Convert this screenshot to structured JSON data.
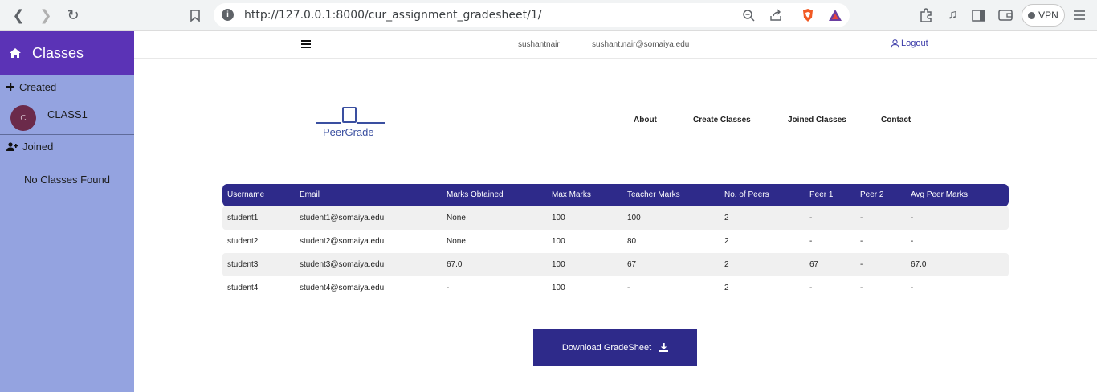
{
  "browser": {
    "url": "http://127.0.0.1:8000/cur_assignment_gradesheet/1/",
    "vpn_label": "VPN"
  },
  "sidebar": {
    "title": "Classes",
    "created_label": "Created",
    "classes": [
      {
        "avatar": "C",
        "name": "CLASS1"
      }
    ],
    "joined_label": "Joined",
    "no_classes": "No Classes Found"
  },
  "header": {
    "username": "sushantnair",
    "email": "sushant.nair@somaiya.edu",
    "logout": "Logout"
  },
  "brand": {
    "name": "PeerGrade",
    "color": "#3a4fa0"
  },
  "nav": {
    "about": "About",
    "create_classes": "Create Classes",
    "joined_classes": "Joined Classes",
    "contact": "Contact"
  },
  "table": {
    "headers": [
      "Username",
      "Email",
      "Marks Obtained",
      "Max Marks",
      "Teacher Marks",
      "No. of Peers",
      "Peer 1",
      "Peer 2",
      "Avg Peer Marks"
    ],
    "rows": [
      [
        "student1",
        "student1@somaiya.edu",
        "None",
        "100",
        "100",
        "2",
        "-",
        "-",
        "-"
      ],
      [
        "student2",
        "student2@somaiya.edu",
        "None",
        "100",
        "80",
        "2",
        "-",
        "-",
        "-"
      ],
      [
        "student3",
        "student3@somaiya.edu",
        "67.0",
        "100",
        "67",
        "2",
        "67",
        "-",
        "67.0"
      ],
      [
        "student4",
        "student4@somaiya.edu",
        "-",
        "100",
        "-",
        "2",
        "-",
        "-",
        "-"
      ]
    ]
  },
  "download_button": "Download GradeSheet",
  "colors": {
    "sidebar_header": "#5b33b6",
    "sidebar_bg": "#94a3e0",
    "primary": "#2e2a8a"
  }
}
